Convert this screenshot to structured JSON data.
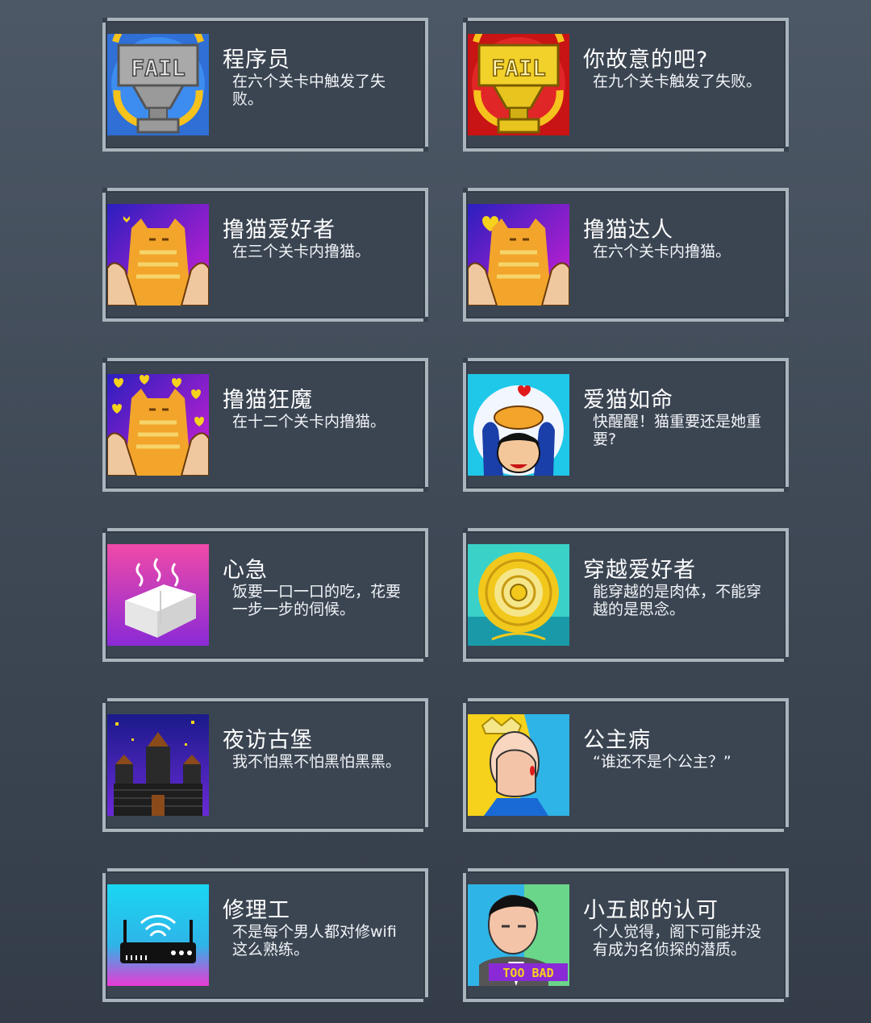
{
  "achievements": [
    {
      "title": "程序员",
      "desc": "在六个关卡中触发了失败。",
      "icon": "fail-trophy-silver-icon"
    },
    {
      "title": "你故意的吧?",
      "desc": "在九个关卡触发了失败。",
      "icon": "fail-trophy-gold-icon"
    },
    {
      "title": "撸猫爱好者",
      "desc": "在三个关卡内撸猫。",
      "icon": "cat-petting-icon"
    },
    {
      "title": "撸猫达人",
      "desc": "在六个关卡内撸猫。",
      "icon": "cat-petting-heart-icon"
    },
    {
      "title": "撸猫狂魔",
      "desc": "在十二个关卡内撸猫。",
      "icon": "cat-petting-hearts-icon"
    },
    {
      "title": "爱猫如命",
      "desc": "快醒醒！猫重要还是她重要?",
      "icon": "cat-on-head-icon"
    },
    {
      "title": "心急",
      "desc": "饭要一口一口的吃，花要一步一步的伺候。",
      "icon": "hot-tofu-icon"
    },
    {
      "title": "穿越爱好者",
      "desc": "能穿越的是肉体，不能穿越的是思念。",
      "icon": "portal-icon"
    },
    {
      "title": "夜访古堡",
      "desc": "我不怕黑不怕黑怕黑黑。",
      "icon": "castle-night-icon"
    },
    {
      "title": "公主病",
      "desc": "“谁还不是个公主？”",
      "icon": "princess-facepalm-icon"
    },
    {
      "title": "修理工",
      "desc": "不是每个男人都对修wifi这么熟练。",
      "icon": "wifi-router-icon"
    },
    {
      "title": "小五郎的认可",
      "desc": "个人觉得，阁下可能并没有成为名侦探的潜质。",
      "icon": "detective-too-bad-icon",
      "badge_text": "TOO BAD"
    }
  ],
  "thumbs": {
    "fail_text": "FAIL"
  }
}
